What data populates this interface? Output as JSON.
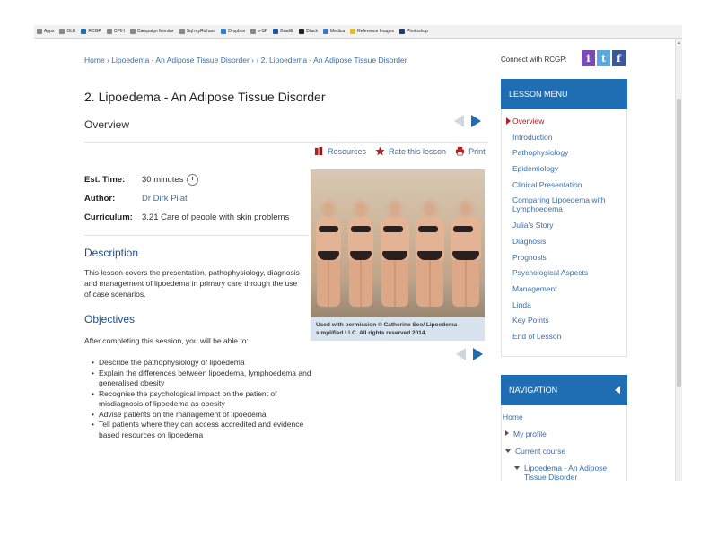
{
  "bookmarks": [
    "Apps",
    "OLE",
    "RCGP",
    "CPIH",
    "Campaign Monitor",
    "Sql myRichard",
    "Dropbox",
    "e-SP",
    "Bradilli",
    "Dtack",
    "Medica",
    "Reference Images",
    "Photoshop"
  ],
  "breadcrumb": {
    "home": "Home",
    "sep1": " › ",
    "item1": "Lipoedema - An Adipose Tissue Disorder",
    "sep2": " › › ",
    "item2": "2. Lipoedema - An Adipose Tissue Disorder"
  },
  "connect": {
    "label": "Connect with RCGP:",
    "icons": [
      "i",
      "t",
      "f"
    ]
  },
  "page": {
    "title": "2. Lipoedema - An Adipose Tissue Disorder",
    "overview": "Overview"
  },
  "toolbar": {
    "resources": "Resources",
    "rate": "Rate this lesson",
    "print": "Print"
  },
  "meta": {
    "est_label": "Est. Time:",
    "est_value": "30 minutes",
    "author_label": "Author:",
    "author_value": "Dr Dirk Pilat",
    "curriculum_label": "Curriculum:",
    "curriculum_value": "3.21 Care of people with skin problems"
  },
  "description": {
    "heading": "Description",
    "body": "This lesson covers the presentation, pathophysiology, diagnosis and management of lipoedema in primary care through the use of case scenarios."
  },
  "objectives": {
    "heading": "Objectives",
    "intro": "After completing this session, you will be able to:",
    "items": [
      "Describe the pathophysiology of lipoedema",
      "Explain the differences between lipoedema, lymphoedema and generalised obesity",
      "Recognise the psychological impact on the patient of misdiagnosis of lipoedema as obesity",
      "Advise patients on the management of lipoedema",
      "Tell patients where they can access accredited and evidence based resources on lipoedema"
    ]
  },
  "image": {
    "caption": "Used with permission © Catherine Seo/ Lipoedema simplified LLC. All rights reserved 2014."
  },
  "lesson_menu": {
    "title": "LESSON MENU",
    "items": [
      "Overview",
      "Introduction",
      "Pathophysiology",
      "Epidemiology",
      "Clinical Presentation",
      "Comparing Lipoedema with Lymphoedema",
      "Julia's Story",
      "Diagnosis",
      "Prognosis",
      "Psychological Aspects",
      "Management",
      "Linda",
      "Key Points",
      "End of Lesson"
    ]
  },
  "navigation": {
    "title": "NAVIGATION",
    "home": "Home",
    "my_profile": "My profile",
    "current_course": "Current course",
    "course_item": "Lipoedema - An Adipose Tissue Disorder"
  },
  "colors": {
    "accent": "#1f6db2",
    "link": "#3a6ea5",
    "active": "#b02121"
  }
}
